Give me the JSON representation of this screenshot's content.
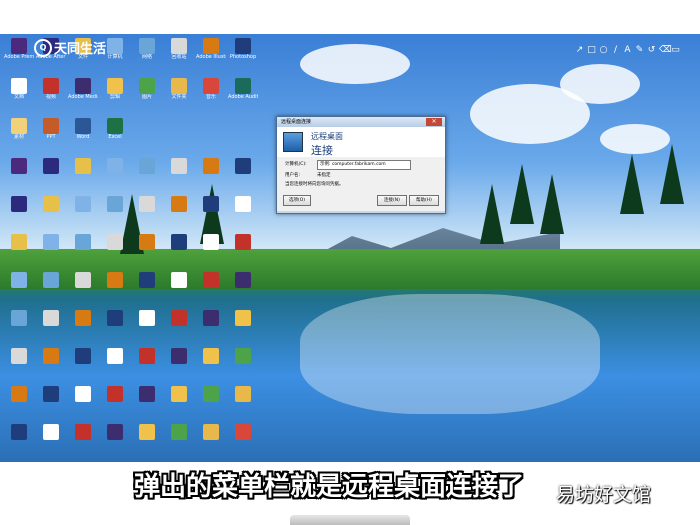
{
  "logo": {
    "text": "天同生活"
  },
  "pen_tools": [
    "↗",
    "□",
    "○",
    "/",
    "A",
    "✎",
    "↺",
    "⌫",
    "▭"
  ],
  "dialog": {
    "title": "远程桌面连接",
    "header_line1": "远程桌面",
    "header_line2": "连接",
    "close": "✕",
    "computer_label": "计算机(C):",
    "computer_value": "示例: computer.fabrikam.com",
    "user_label": "用户名:",
    "user_value": "未指定",
    "hint": "当您连接时将向您询问凭据。",
    "options": "选项(O)",
    "connect": "连接(N)",
    "help": "帮助(H)"
  },
  "desktop_icons": [
    {
      "label": "Adobe Premiere",
      "color": "#4b2a7d"
    },
    {
      "label": "Adobe After Effects",
      "color": "#2b2a7d"
    },
    {
      "label": "文件",
      "color": "#e7c04a"
    },
    {
      "label": "计算机",
      "color": "#7fb3e8"
    },
    {
      "label": "网络",
      "color": "#6aa5d8"
    },
    {
      "label": "回收站",
      "color": "#d9d9d9"
    },
    {
      "label": "Adobe Illustrator",
      "color": "#d77a14"
    },
    {
      "label": "Photoshop",
      "color": "#1f3d7a"
    },
    {
      "label": "文档",
      "color": "#ffffff"
    },
    {
      "label": "视频",
      "color": "#c2322b"
    },
    {
      "label": "Adobe Media Encoder",
      "color": "#3b2d6e"
    },
    {
      "label": "剪辑",
      "color": "#f0c24c"
    },
    {
      "label": "图片",
      "color": "#4da34a"
    },
    {
      "label": "文件夹",
      "color": "#e8b84a"
    },
    {
      "label": "音乐",
      "color": "#d9473a"
    },
    {
      "label": "Adobe Audition",
      "color": "#1a6b5a"
    },
    {
      "label": "素材",
      "color": "#f1d27a"
    },
    {
      "label": "PPT",
      "color": "#c55a2b"
    },
    {
      "label": "Word",
      "color": "#2b5797"
    },
    {
      "label": "Excel",
      "color": "#1e7145"
    }
  ],
  "subtitle": "弹出的菜单栏就是远程桌面连接了",
  "watermark": "易坊好文馆"
}
